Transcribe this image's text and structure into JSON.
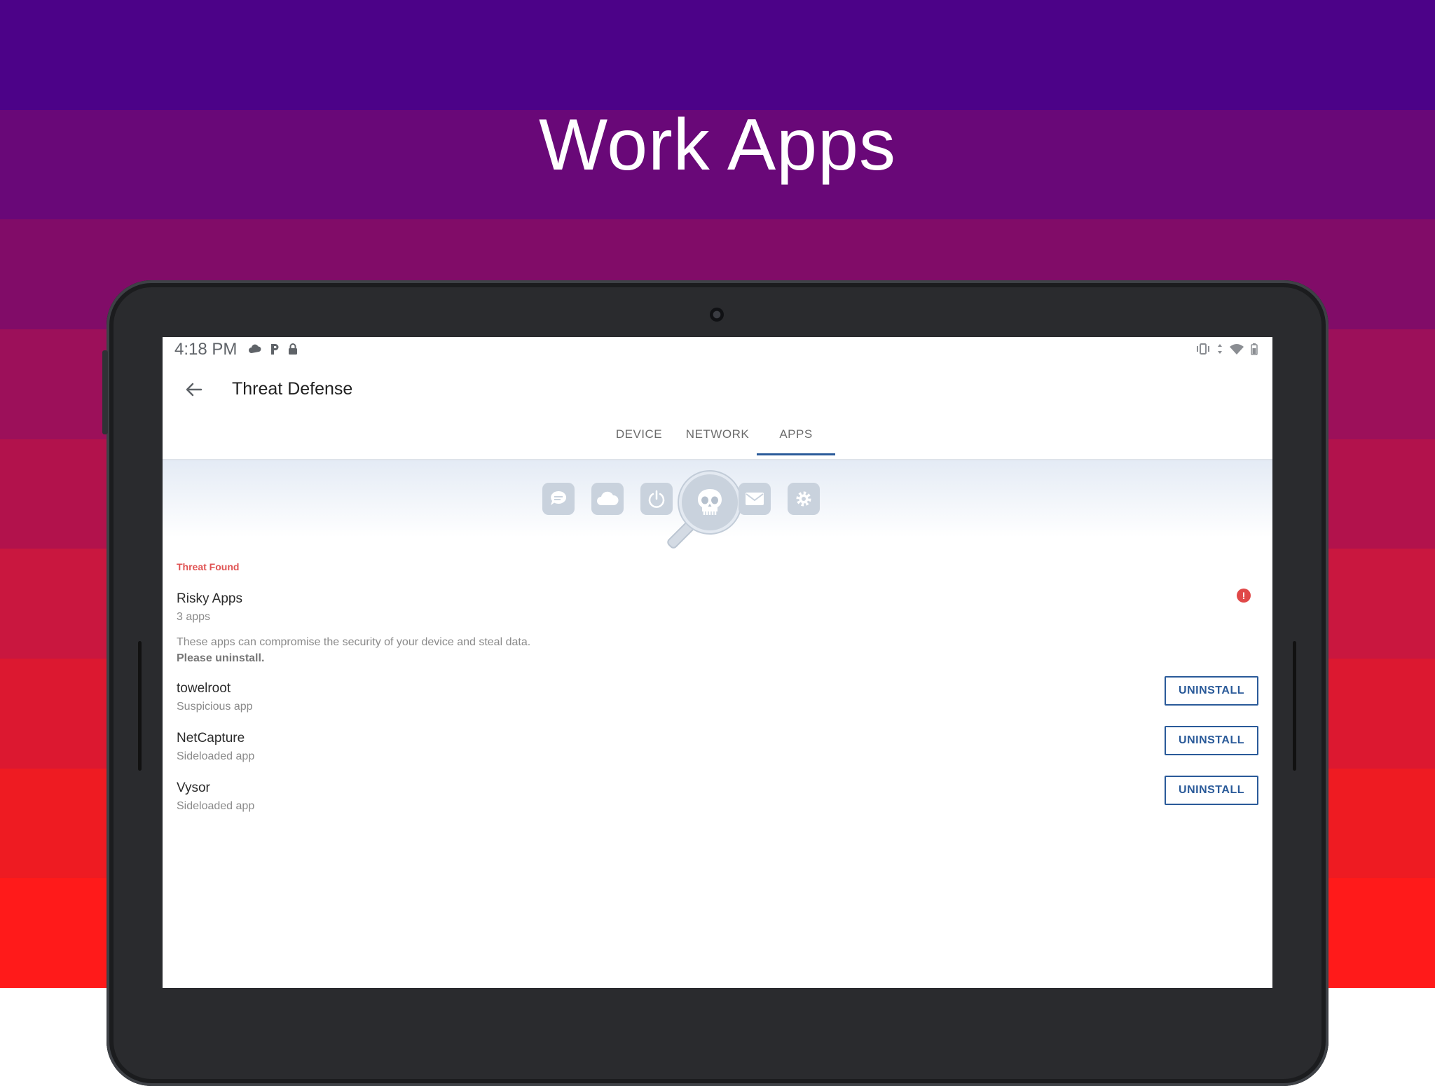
{
  "colors": {
    "bands": [
      "#4c0288",
      "#690878",
      "#810c68",
      "#9c105a",
      "#b2124c",
      "#c9173f",
      "#dc1830",
      "#ee1b22",
      "#ff1a1a"
    ],
    "accent": "#2a5a99",
    "threat": "#e05454"
  },
  "promo": {
    "headline": "Work Apps"
  },
  "statusbar": {
    "time": "4:18 PM",
    "left_icons": [
      "cloud-icon",
      "parking-icon",
      "lock-icon"
    ],
    "right_icons": [
      "vibrate-icon",
      "data-arrows-icon",
      "wifi-icon",
      "battery-icon"
    ]
  },
  "appbar": {
    "title": "Threat Defense",
    "back_icon": "arrow-back-icon"
  },
  "tabs": [
    {
      "label": "DEVICE",
      "active": false
    },
    {
      "label": "NETWORK",
      "active": false
    },
    {
      "label": "APPS",
      "active": true
    }
  ],
  "hero_icons": [
    "chat-icon",
    "cloud-icon",
    "power-icon",
    "skull-magnifier-icon",
    "mail-icon",
    "gear-icon"
  ],
  "threat": {
    "section_label": "Threat Found",
    "title": "Risky Apps",
    "count": "3 apps",
    "description": "These apps can compromise the security of your device and steal data.",
    "instruction": "Please uninstall.",
    "alert_icon": "!"
  },
  "apps": [
    {
      "name": "towelroot",
      "type": "Suspicious app",
      "action": "UNINSTALL"
    },
    {
      "name": "NetCapture",
      "type": "Sideloaded app",
      "action": "UNINSTALL"
    },
    {
      "name": "Vysor",
      "type": "Sideloaded app",
      "action": "UNINSTALL"
    }
  ]
}
